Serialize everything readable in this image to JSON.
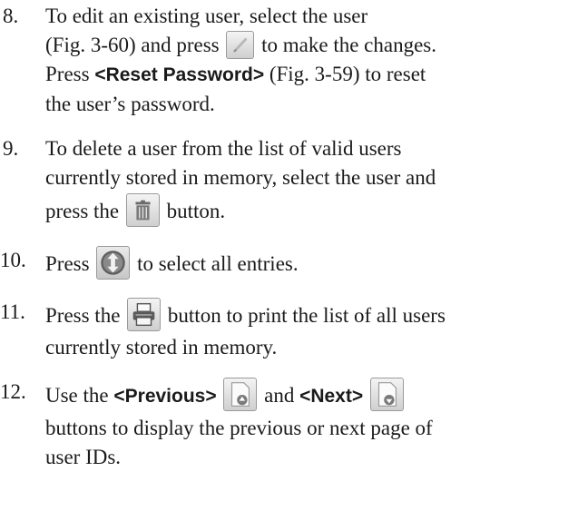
{
  "steps": [
    {
      "num": "8.",
      "l1": "To edit an existing user, select the user",
      "l2a": "(Fig. 3-60) and press",
      "l2b": "to make the changes.",
      "l3a": "Press",
      "l3b": "<Reset Password>",
      "l3c": "(Fig. 3-59) to reset",
      "l4": "the user’s password.",
      "icon": "pencil-icon"
    },
    {
      "num": "9.",
      "l1": "To delete a user from the list of valid users",
      "l2": "currently stored in memory, select the user and",
      "l3a": "press the",
      "l3b": "button.",
      "icon": "trash-icon"
    },
    {
      "num": "10.",
      "a": "Press",
      "b": "to select all entries.",
      "icon": "select-all-icon"
    },
    {
      "num": "11.",
      "l1a": "Press the",
      "l1b": "button to print the list of all users",
      "l2": "currently stored in memory.",
      "icon": "printer-icon"
    },
    {
      "num": "12.",
      "l1a": "Use the",
      "prev": "<Previous>",
      "and": "and",
      "next": "<Next>",
      "l2": "buttons to display the previous or next page of",
      "l3": "user IDs.",
      "icon_prev": "previous-page-icon",
      "icon_next": "next-page-icon"
    }
  ]
}
